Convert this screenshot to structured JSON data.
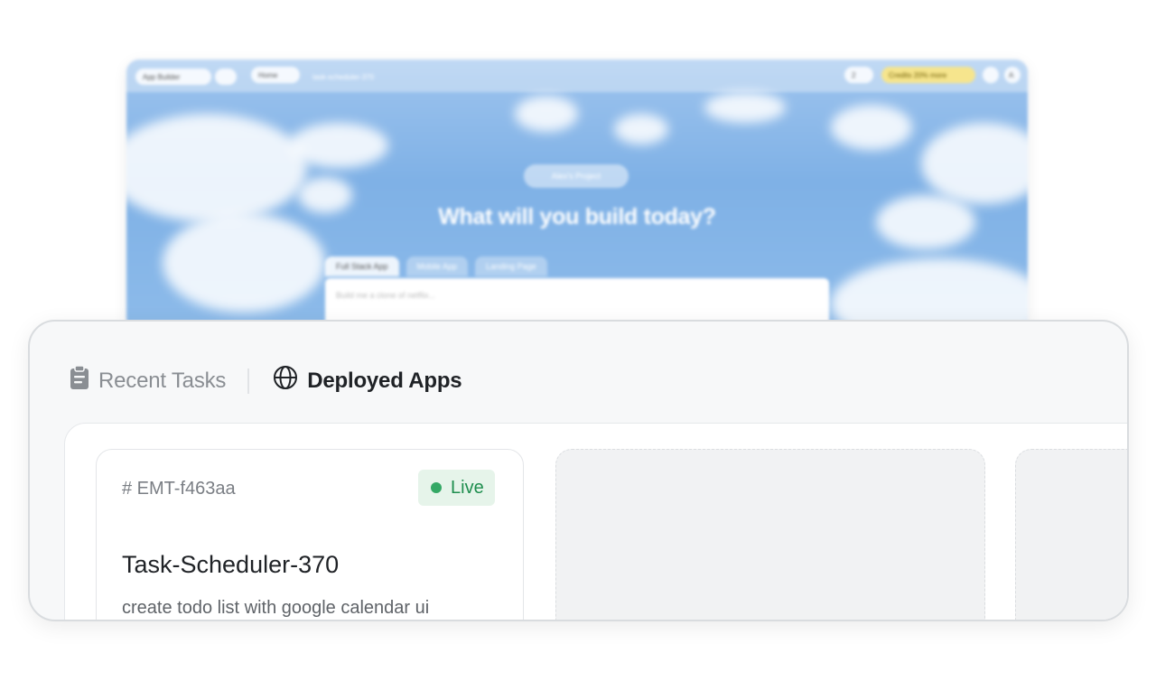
{
  "background_app": {
    "app_builder_label": "App Builder",
    "active_tab": "Home",
    "breadcrumb": "task-scheduler-370",
    "counter": "2",
    "credits_label": "Credits",
    "credits_badge": "20% more",
    "avatar_initial": "A",
    "project_label": "Alex's Project",
    "heading": "What will you build today?",
    "mode_tabs": [
      "Full Stack App",
      "Mobile App",
      "Landing Page"
    ],
    "prompt_placeholder": "Build me a clone of netflix..."
  },
  "panel": {
    "tabs": [
      {
        "label": "Recent Tasks",
        "icon": "clipboard-icon",
        "active": false
      },
      {
        "label": "Deployed Apps",
        "icon": "globe-icon",
        "active": true
      }
    ],
    "apps": [
      {
        "id": "# EMT-f463aa",
        "status": "Live",
        "name": "Task-Scheduler-370",
        "description": "create todo list with google calendar ui"
      }
    ]
  },
  "colors": {
    "live_bg": "#e6f4ea",
    "live_text": "#1e8e4e",
    "live_dot": "#34a865",
    "panel_border": "#d9dcdf"
  }
}
